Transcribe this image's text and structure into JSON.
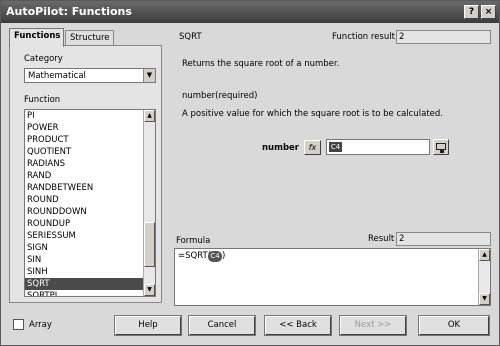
{
  "window": {
    "title": "AutoPilot: Functions",
    "help_btn": "?",
    "close_btn": "×"
  },
  "tabs": [
    {
      "label": "Functions",
      "active": true
    },
    {
      "label": "Structure",
      "active": false
    }
  ],
  "category": {
    "label": "Category",
    "value": "Mathematical"
  },
  "function_list": {
    "label": "Function",
    "items": [
      "PI",
      "POWER",
      "PRODUCT",
      "QUOTIENT",
      "RADIANS",
      "RAND",
      "RANDBETWEEN",
      "ROUND",
      "ROUNDDOWN",
      "ROUNDUP",
      "SERIESSUM",
      "SIGN",
      "SIN",
      "SINH",
      "SQRT",
      "SQRTPI"
    ],
    "selected": "SQRT"
  },
  "details": {
    "function_name": "SQRT",
    "function_result_label": "Function result",
    "function_result_value": "2",
    "description": "Returns the square root of a number.",
    "param_name": "number(required)",
    "param_description": "A positive value for which the square root is to be calculated."
  },
  "argument": {
    "label": "number",
    "fx": "fx",
    "value": "C4"
  },
  "formula": {
    "label": "Formula",
    "result_label": "Result",
    "result_value": "2",
    "prefix": "=SQRT(",
    "ref": "C4",
    "suffix": ")"
  },
  "array": {
    "label": "Array"
  },
  "buttons": {
    "help": "Help",
    "cancel": "Cancel",
    "back": "<< Back",
    "next": "Next >>",
    "ok": "OK"
  }
}
